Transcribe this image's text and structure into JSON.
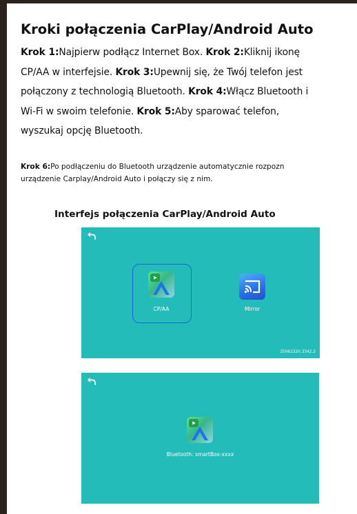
{
  "title": "Kroki połączenia CarPlay/Android Auto",
  "steps": {
    "s1_label": "Krok 1:",
    "s1_text": "Najpierw podłącz Internet Box. ",
    "s2_label": "Krok 2:",
    "s2_text_a": "Kliknij ikonę",
    "s2_text_b": "CP/AA w interfejsie. ",
    "s3_label": "Krok 3:",
    "s3_text_a": "Upewnij się, że Twój telefon jest",
    "s3_text_b": "połączony z technologią Bluetooth. ",
    "s4_label": "Krok 4:",
    "s4_text_a": "Włącz Bluetooth i",
    "s4_text_b": "Wi-Fi w swoim telefonie. ",
    "s5_label": "Krok 5:",
    "s5_text_a": "Aby sparować telefon,",
    "s5_text_b": "wyszukaj opcję Bluetooth."
  },
  "note": {
    "label": "Krok 6:",
    "text_a": "Po podłączeniu do Bluetooth urządzenie automatycznie rozpozn",
    "text_b": "urządzenie Carplay/Android Auto i połączy się z nim."
  },
  "caption": "Interfejs połączenia CarPlay/Android Auto",
  "screen1": {
    "back_icon": "back-arrow-icon",
    "cpaa_label": "CP/AA",
    "mirror_label": "Mirror",
    "version": "25062320.3342.2"
  },
  "screen2": {
    "back_icon": "back-arrow-icon",
    "bluetooth_label": "Bluetooth: smartBox-xxxx"
  },
  "colors": {
    "screen_bg": "#24bcb8",
    "selection_border": "#1565d8",
    "frame": "#2a221d"
  }
}
